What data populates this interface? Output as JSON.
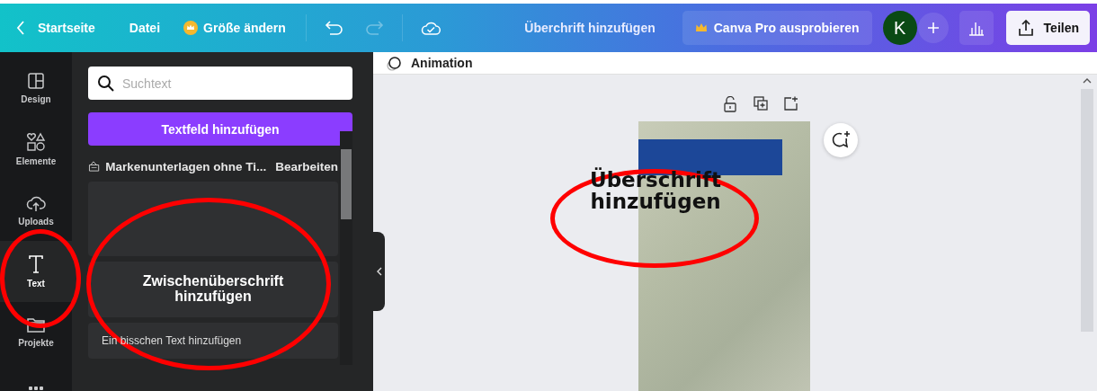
{
  "topbar": {
    "back_label": "Startseite",
    "menu": [
      {
        "label": "Datei",
        "kind": "plain"
      },
      {
        "label": "Größe ändern",
        "kind": "pro"
      }
    ],
    "undo_disabled": false,
    "redo_disabled": true,
    "design_title": "Überchrift hinzufügen",
    "pro_button": "Canva Pro ausprobieren",
    "avatar": "K",
    "share": "Teilen"
  },
  "sidebar": {
    "items": [
      {
        "label": "Design",
        "selected": false
      },
      {
        "label": "Elemente",
        "selected": false
      },
      {
        "label": "Uploads",
        "selected": false
      },
      {
        "label": "Text",
        "selected": true
      },
      {
        "label": "Projekte",
        "selected": false
      },
      {
        "selected": false
      }
    ]
  },
  "panel": {
    "search": {
      "placeholder": "Suchtext"
    },
    "add_button": "Textfeld hinzufügen",
    "brand": {
      "title": "Markenunterlagen ohne Ti...",
      "action": "Bearbeiten"
    },
    "styles": [
      {
        "kind": "blank"
      },
      {
        "kind": "subheading",
        "text": "Zwischenüberschrift hinzufügen"
      },
      {
        "kind": "body",
        "text": "Ein bisschen Text hinzufügen"
      }
    ]
  },
  "toolbar": {
    "animation": "Animation"
  },
  "canvas": {
    "heading": "Überschrift hinzufügen"
  }
}
